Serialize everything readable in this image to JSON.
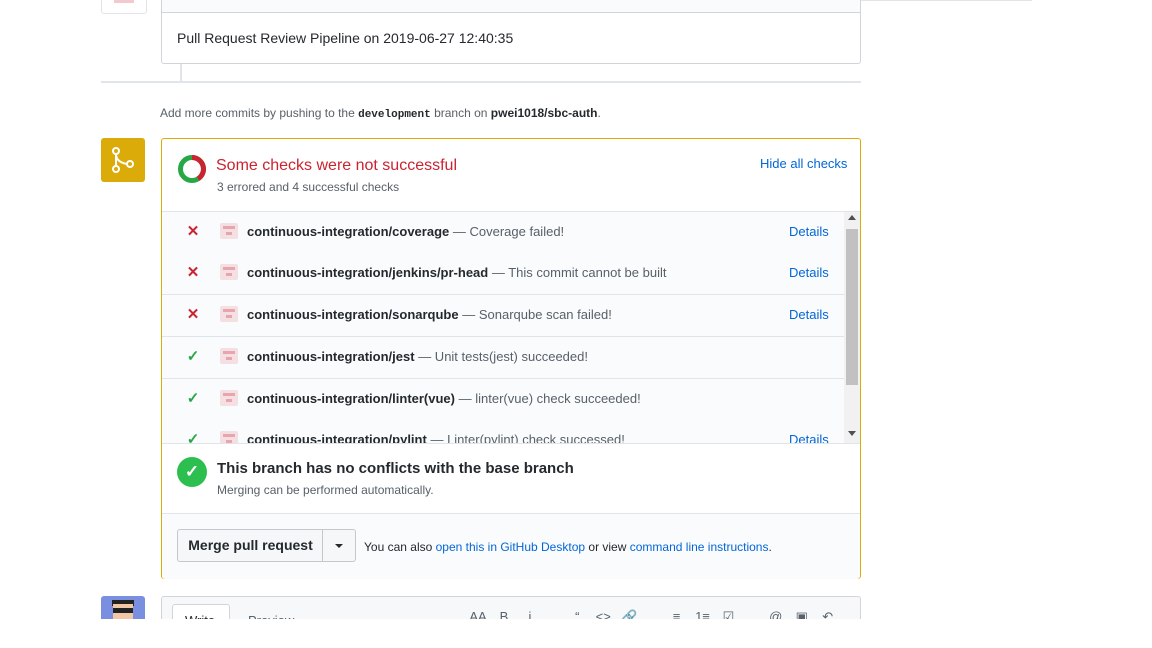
{
  "previous_event": {
    "text": "Pull Request Review Pipeline on 2019-06-27 12:40:35"
  },
  "hint": {
    "prefix": "Add more commits by pushing to the",
    "branch": "development",
    "middle": "branch on",
    "repo": "pwei1018/sbc-auth",
    "suffix": "."
  },
  "checks_summary": {
    "title": "Some checks were not successful",
    "subtitle": "3 errored and 4 successful checks",
    "toggle_label": "Hide all checks",
    "ring_colors": {
      "error": "#cb2431",
      "success": "#28a745"
    }
  },
  "checks": [
    {
      "status": "failed",
      "icon": "x-icon",
      "name": "continuous-integration/coverage",
      "description": "— Coverage failed!",
      "details": "Details"
    },
    {
      "status": "failed",
      "icon": "x-icon",
      "name": "continuous-integration/jenkins/pr-head",
      "description": "— This commit cannot be built",
      "details": "Details"
    },
    {
      "status": "failed",
      "icon": "x-icon",
      "name": "continuous-integration/sonarqube",
      "description": "— Sonarqube scan failed!",
      "details": "Details"
    },
    {
      "status": "success",
      "icon": "check-icon",
      "name": "continuous-integration/jest",
      "description": "— Unit tests(jest) succeeded!",
      "details": ""
    },
    {
      "status": "success",
      "icon": "check-icon",
      "name": "continuous-integration/linter(vue)",
      "description": "— linter(vue) check succeeded!",
      "details": ""
    },
    {
      "status": "success",
      "icon": "check-icon",
      "name": "continuous-integration/pylint",
      "description": "— Linter(pylint) check successed!",
      "details": "Details"
    }
  ],
  "merge_status": {
    "title": "This branch has no conflicts with the base branch",
    "subtitle": "Merging can be performed automatically."
  },
  "merge_footer": {
    "button_label": "Merge pull request",
    "prefix": "You can also",
    "desktop_link": "open this in GitHub Desktop",
    "middle": "or view",
    "cli_link": "command line instructions",
    "suffix": "."
  },
  "comment": {
    "write_tab": "Write",
    "preview_tab": "Preview",
    "toolbar": [
      "AA",
      "B",
      "i",
      "“",
      "<>",
      "🔗",
      "≡",
      "1≡",
      "☑",
      "@",
      "▣",
      "↶"
    ]
  },
  "colors": {
    "accent": "#dbab09",
    "link": "#0366d6",
    "error": "#cb2431",
    "success": "#28a745"
  }
}
